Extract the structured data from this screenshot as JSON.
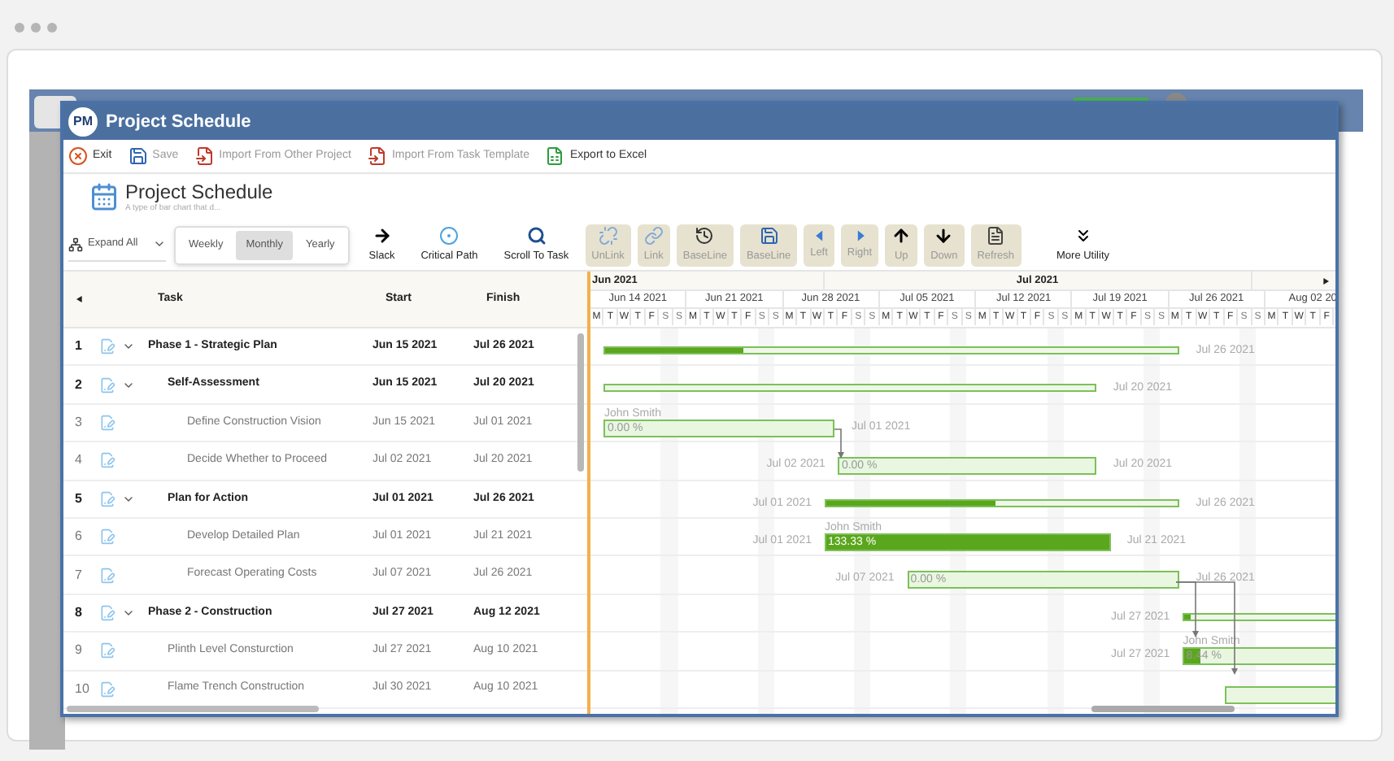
{
  "window": {
    "logo": "PM",
    "title": "Project Schedule"
  },
  "toolbar": [
    {
      "label": "Exit",
      "disabled": false
    },
    {
      "label": "Save",
      "disabled": true
    },
    {
      "label": "Import From Other Project",
      "disabled": true
    },
    {
      "label": "Import From Task Template",
      "disabled": true
    },
    {
      "label": "Export to Excel",
      "disabled": false
    }
  ],
  "header": {
    "title": "Project Schedule",
    "subtitle": "A type of bar chart that d..."
  },
  "expand": {
    "label": "Expand All"
  },
  "views": [
    {
      "label": "Weekly",
      "selected": false
    },
    {
      "label": "Monthly",
      "selected": true
    },
    {
      "label": "Yearly",
      "selected": false
    }
  ],
  "utilities": [
    {
      "kind": "plain",
      "label": "Slack",
      "disabled": false
    },
    {
      "kind": "plain",
      "label": "Critical Path",
      "disabled": false
    },
    {
      "kind": "plain",
      "label": "Scroll To Task",
      "disabled": false
    },
    {
      "kind": "tile",
      "label": "UnLink",
      "disabled": true
    },
    {
      "kind": "tile",
      "label": "Link",
      "disabled": true
    },
    {
      "kind": "tile",
      "label": "BaseLine",
      "disabled": true
    },
    {
      "kind": "tile",
      "label": "BaseLine",
      "disabled": true
    },
    {
      "kind": "tile",
      "label": "Left",
      "disabled": true
    },
    {
      "kind": "tile",
      "label": "Right",
      "disabled": true
    },
    {
      "kind": "tile",
      "label": "Up",
      "disabled": true
    },
    {
      "kind": "tile",
      "label": "Down",
      "disabled": true
    },
    {
      "kind": "tile",
      "label": "Refresh",
      "disabled": true
    },
    {
      "kind": "plain",
      "label": "More Utility",
      "disabled": false
    }
  ],
  "table": {
    "columns": [
      "Task",
      "Start",
      "Finish"
    ]
  },
  "timeline": {
    "months": [
      "Jun 2021",
      "Jul 2021"
    ],
    "weeks": [
      {
        "label": "Jun 14 2021",
        "days": [
          "M",
          "T",
          "W",
          "T",
          "F",
          "S",
          "S"
        ]
      },
      {
        "label": "Jun 21 2021",
        "days": [
          "M",
          "T",
          "W",
          "T",
          "F",
          "S",
          "S"
        ]
      },
      {
        "label": "Jun 28 2021",
        "days": [
          "M",
          "T",
          "W",
          "T",
          "F",
          "S",
          "S"
        ]
      },
      {
        "label": "Jul 05 2021",
        "days": [
          "M",
          "T",
          "W",
          "T",
          "F",
          "S",
          "S"
        ]
      },
      {
        "label": "Jul 12 2021",
        "days": [
          "M",
          "T",
          "W",
          "T",
          "F",
          "S",
          "S"
        ]
      },
      {
        "label": "Jul 19 2021",
        "days": [
          "M",
          "T",
          "W",
          "T",
          "F",
          "S",
          "S"
        ]
      },
      {
        "label": "Jul 26 2021",
        "days": [
          "M",
          "T",
          "W",
          "T",
          "F",
          "S",
          "S"
        ]
      },
      {
        "label": "Aug 02 20",
        "days": [
          "M",
          "T",
          "W",
          "T",
          "F"
        ]
      }
    ]
  },
  "tasks": [
    {
      "num": "1",
      "task": "Phase 1 - Strategic Plan",
      "start": "Jun 15 2021",
      "finish": "Jul 26 2021",
      "expanded": true,
      "bar": {
        "kind": "summary",
        "level": 0.24,
        "right_label": "Jul 26 2021"
      },
      "children": [
        {
          "num": "2",
          "task": "Self-Assessment",
          "start": "Jun 15 2021",
          "finish": "Jul 20 2021",
          "expanded": true,
          "bar": {
            "kind": "summary",
            "right_label": "Jul 20 2021"
          },
          "children": [
            {
              "num": "3",
              "task": "Define Construction Vision",
              "start": "Jun 15 2021",
              "finish": "Jul 01 2021",
              "bar": {
                "kind": "task",
                "resource": "John Smith",
                "progress_text": "0.00 %",
                "right_label": "Jul 01 2021"
              }
            },
            {
              "num": "4",
              "task": "Decide Whether to Proceed",
              "start": "Jul 02 2021",
              "finish": "Jul 20 2021",
              "bar": {
                "kind": "task",
                "left_label": "Jul 02 2021",
                "progress_text": "0.00 %",
                "right_label": "Jul 20 2021"
              }
            }
          ]
        },
        {
          "num": "5",
          "task": "Plan for Action",
          "start": "Jul 01 2021",
          "finish": "Jul 26 2021",
          "expanded": true,
          "bar": {
            "kind": "summary",
            "level": 0.48,
            "left_label": "Jul 01 2021",
            "right_label": "Jul 26 2021"
          },
          "children": [
            {
              "num": "6",
              "task": "Develop Detailed Plan",
              "start": "Jul 01 2021",
              "finish": "Jul 21 2021",
              "bar": {
                "kind": "task",
                "level": 1,
                "resource": "John Smith",
                "left_label": "Jul 01 2021",
                "progress_text": "133.33 %",
                "right_label": "Jul 21 2021"
              }
            },
            {
              "num": "7",
              "task": "Forecast Operating Costs",
              "start": "Jul 07 2021",
              "finish": "Jul 26 2021",
              "bar": {
                "kind": "task",
                "left_label": "Jul 07 2021",
                "progress_text": "0.00 %",
                "right_label": "Jul 26 2021"
              }
            }
          ]
        }
      ]
    },
    {
      "num": "8",
      "task": "Phase 2 - Construction",
      "start": "Jul 27 2021",
      "finish": "Aug 12 2021",
      "expanded": true,
      "bar": {
        "kind": "summary",
        "level": 0.03,
        "left_label": "Jul 27 2021"
      },
      "children": [
        {
          "num": "9",
          "task": "Plinth Level Consturction",
          "start": "Jul 27 2021",
          "finish": "Aug 10 2021",
          "bar": {
            "kind": "task",
            "level": 0.08,
            "resource": "John Smith",
            "left_label": "Jul 27 2021",
            "progress_text": "8.44 %"
          }
        },
        {
          "num": "10",
          "task": "Flame Trench Construction",
          "start": "Jul 30 2021",
          "finish": "Aug 10 2021",
          "bar": {
            "kind": "task"
          }
        }
      ]
    }
  ]
}
